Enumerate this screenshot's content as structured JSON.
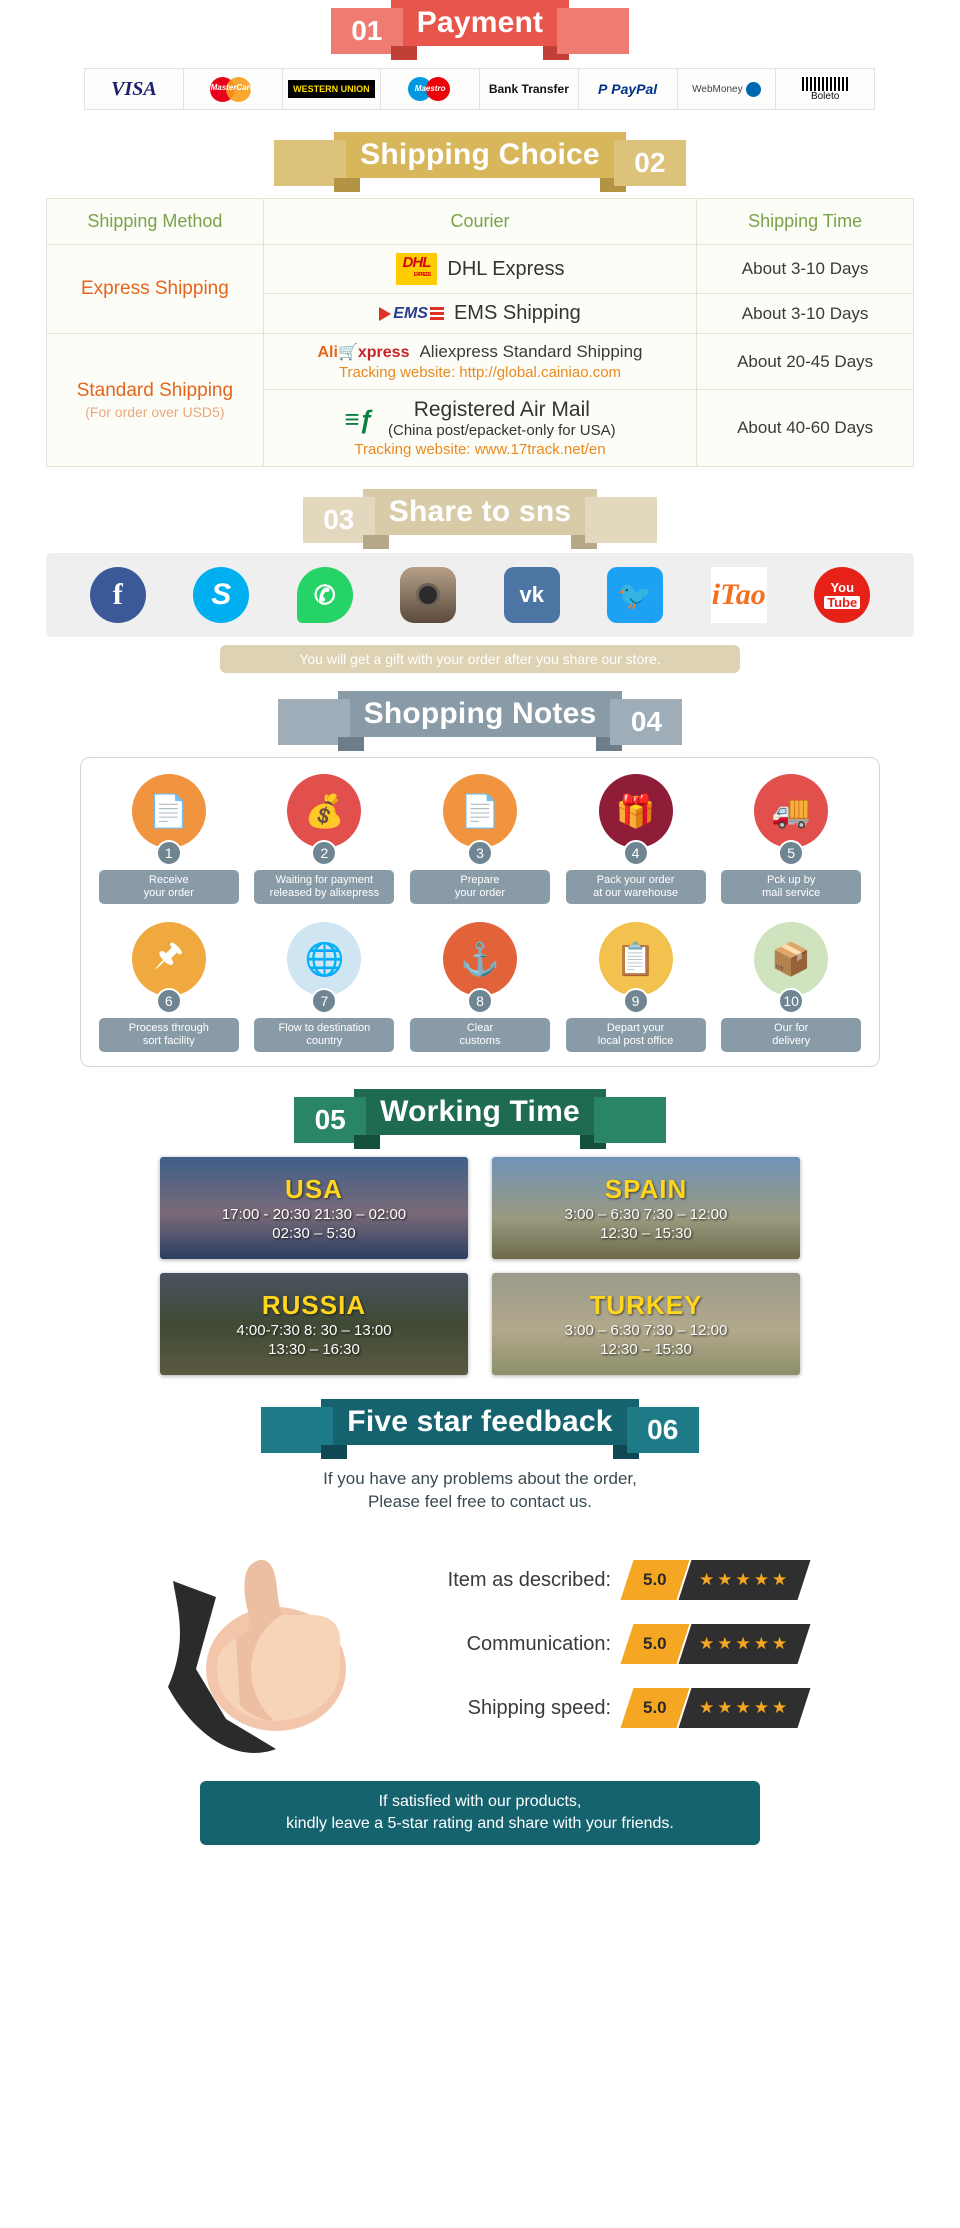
{
  "sections": {
    "payment": {
      "number": "01",
      "title": "Payment",
      "methods": [
        {
          "name": "visa-logo",
          "label": "VISA"
        },
        {
          "name": "mastercard-logo",
          "label": "MasterCard"
        },
        {
          "name": "western-union-logo",
          "label": "WESTERN UNION"
        },
        {
          "name": "maestro-logo",
          "label": "Maestro"
        },
        {
          "name": "bank-transfer-logo",
          "label": "Bank Transfer"
        },
        {
          "name": "paypal-logo",
          "label": "PayPal"
        },
        {
          "name": "webmoney-logo",
          "label": "WebMoney"
        },
        {
          "name": "boleto-logo",
          "label": "Boleto"
        }
      ]
    },
    "shipping": {
      "number": "02",
      "title": "Shipping Choice",
      "headers": [
        "Shipping Method",
        "Courier",
        "Shipping Time"
      ],
      "groups": [
        {
          "method": "Express Shipping",
          "method_sub": "",
          "rows": [
            {
              "logo": "dhl-logo",
              "courier": "DHL Express",
              "tracking": "",
              "sub": "",
              "time": "About 3-10 Days"
            },
            {
              "logo": "ems-logo",
              "courier": "EMS Shipping",
              "tracking": "",
              "sub": "",
              "time": "About 3-10 Days"
            }
          ]
        },
        {
          "method": "Standard Shipping",
          "method_sub": "(For order over USD5)",
          "rows": [
            {
              "logo": "aliexpress-logo",
              "courier": "Aliexpress Standard Shipping",
              "tracking": "Tracking website: http://global.cainiao.com",
              "sub": "",
              "time": "About 20-45 Days"
            },
            {
              "logo": "china-post-logo",
              "courier": "Registered Air Mail",
              "sub": "(China post/epacket-only for USA)",
              "tracking": "Tracking website: www.17track.net/en",
              "time": "About 40-60 Days"
            }
          ]
        }
      ]
    },
    "share": {
      "number": "03",
      "title": "Share to sns",
      "networks": [
        {
          "name": "facebook-icon",
          "label": "f"
        },
        {
          "name": "skype-icon",
          "label": "S"
        },
        {
          "name": "whatsapp-icon",
          "label": "✆"
        },
        {
          "name": "instagram-icon",
          "label": ""
        },
        {
          "name": "vk-icon",
          "label": "vk"
        },
        {
          "name": "twitter-icon",
          "label": "ᵗ"
        },
        {
          "name": "itao-icon",
          "label": "iTao"
        },
        {
          "name": "youtube-icon",
          "label": "You"
        }
      ],
      "youtube_sub": "Tube",
      "note": "You will get a gift with your order after you share our store."
    },
    "notes": {
      "number": "04",
      "title": "Shopping Notes",
      "steps": [
        {
          "num": "1",
          "label": "Receive\nyour order",
          "icon": "document-icon",
          "color": "#f0943f"
        },
        {
          "num": "2",
          "label": "Waiting for payment\nreleased by alixepress",
          "icon": "money-bag-icon",
          "color": "#e2504e"
        },
        {
          "num": "3",
          "label": "Prepare\nyour order",
          "icon": "document-icon",
          "color": "#f0943f"
        },
        {
          "num": "4",
          "label": "Pack your order\nat our warehouse",
          "icon": "gift-icon",
          "color": "#8f1d38"
        },
        {
          "num": "5",
          "label": "Pck up by\nmail service",
          "icon": "mail-truck-icon",
          "color": "#e2504e"
        },
        {
          "num": "6",
          "label": "Process through\nsort facility",
          "icon": "stamp-icon",
          "color": "#f0a93f"
        },
        {
          "num": "7",
          "label": "Flow to destination\ncountry",
          "icon": "globe-icon",
          "color": "#cfe5f2"
        },
        {
          "num": "8",
          "label": "Clear\ncustoms",
          "icon": "anchor-icon",
          "color": "#e2623a"
        },
        {
          "num": "9",
          "label": "Depart your\nlocal post office",
          "icon": "clipboard-icon",
          "color": "#f2c14e"
        },
        {
          "num": "10",
          "label": "Our for\ndelivery",
          "icon": "package-icon",
          "color": "#cfe3bf"
        }
      ]
    },
    "working_time": {
      "number": "05",
      "title": "Working Time",
      "cards": [
        {
          "country": "USA",
          "times": "17:00 - 20:30  21:30 – 02:00\n02:30 – 5:30"
        },
        {
          "country": "SPAIN",
          "times": "3:00 – 6:30   7:30 – 12:00\n12:30 – 15:30"
        },
        {
          "country": "RUSSIA",
          "times": "4:00-7:30   8: 30 – 13:00\n13:30 – 16:30"
        },
        {
          "country": "TURKEY",
          "times": "3:00 – 6:30   7:30 – 12:00\n12:30 – 15:30"
        }
      ]
    },
    "feedback": {
      "number": "06",
      "title": "Five star feedback",
      "intro": "If you have any problems about the order,\nPlease feel free to contact us.",
      "ratings": [
        {
          "label": "Item as described:",
          "score": "5.0",
          "stars": "★★★★★"
        },
        {
          "label": "Communication:",
          "score": "5.0",
          "stars": "★★★★★"
        },
        {
          "label": "Shipping speed:",
          "score": "5.0",
          "stars": "★★★★★"
        }
      ],
      "footer": "If satisfied with our products,\nkindly leave a 5-star rating and share with your friends."
    }
  },
  "colors": {
    "payment": "#e8554a",
    "shipping": "#d8b75c",
    "share": "#d8cba8",
    "notes": "#8a9ba8",
    "working": "#1e6b52",
    "feedback": "#15636f",
    "accent_orange": "#e4651d",
    "star": "#f5a623"
  }
}
